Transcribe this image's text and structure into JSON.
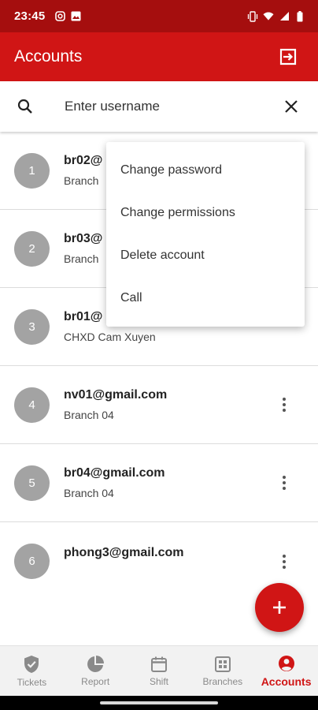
{
  "status_bar": {
    "time": "23:45",
    "left_icons": [
      "instagram-icon",
      "image-icon"
    ],
    "right_icons": [
      "vibrate-icon",
      "wifi-icon",
      "signal-icon",
      "battery-icon"
    ]
  },
  "app_bar": {
    "title": "Accounts",
    "action_icon": "logout-icon"
  },
  "search": {
    "placeholder": "Enter username",
    "value": ""
  },
  "accounts": [
    {
      "index": "1",
      "email": "br02@",
      "branch": "Branch"
    },
    {
      "index": "2",
      "email": "br03@",
      "branch": "Branch"
    },
    {
      "index": "3",
      "email": "br01@",
      "branch": "CHXD Cam Xuyen"
    },
    {
      "index": "4",
      "email": "nv01@gmail.com",
      "branch": "Branch 04"
    },
    {
      "index": "5",
      "email": "br04@gmail.com",
      "branch": "Branch 04"
    },
    {
      "index": "6",
      "email": "phong3@gmail.com",
      "branch": ""
    }
  ],
  "context_menu": {
    "items": [
      "Change password",
      "Change permissions",
      "Delete account",
      "Call"
    ]
  },
  "fab": {
    "icon": "plus-icon"
  },
  "bottom_nav": {
    "items": [
      {
        "label": "Tickets",
        "icon": "shield-check-icon"
      },
      {
        "label": "Report",
        "icon": "pie-chart-icon"
      },
      {
        "label": "Shift",
        "icon": "calendar-icon"
      },
      {
        "label": "Branches",
        "icon": "store-icon"
      },
      {
        "label": "Accounts",
        "icon": "account-circle-icon"
      }
    ],
    "active_index": 4
  },
  "colors": {
    "status_bar": "#a50e0e",
    "primary": "#d01515",
    "avatar": "#a3a3a3",
    "nav_inactive": "#8a8a8a"
  }
}
